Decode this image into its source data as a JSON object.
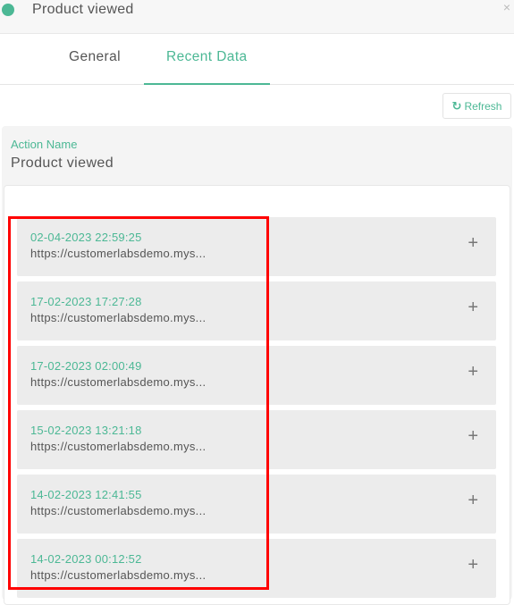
{
  "header": {
    "title": "Product viewed",
    "status_color": "#4cb895",
    "close_glyph": "×"
  },
  "tabs": [
    {
      "label": "General",
      "active": false
    },
    {
      "label": "Recent Data",
      "active": true
    }
  ],
  "toolbar": {
    "refresh_label": "Refresh",
    "refresh_icon": "↻"
  },
  "action": {
    "label": "Action Name",
    "value": "Product viewed"
  },
  "events": [
    {
      "date": "02-04-2023 22:59:25",
      "url": "https://customerlabsdemo.mys..."
    },
    {
      "date": "17-02-2023 17:27:28",
      "url": "https://customerlabsdemo.mys..."
    },
    {
      "date": "17-02-2023 02:00:49",
      "url": "https://customerlabsdemo.mys..."
    },
    {
      "date": "15-02-2023 13:21:18",
      "url": "https://customerlabsdemo.mys..."
    },
    {
      "date": "14-02-2023 12:41:55",
      "url": "https://customerlabsdemo.mys..."
    },
    {
      "date": "14-02-2023 00:12:52",
      "url": "https://customerlabsdemo.mys..."
    }
  ],
  "expand_glyph": "+",
  "colors": {
    "accent": "#4cb895",
    "highlight": "#ff0000"
  }
}
